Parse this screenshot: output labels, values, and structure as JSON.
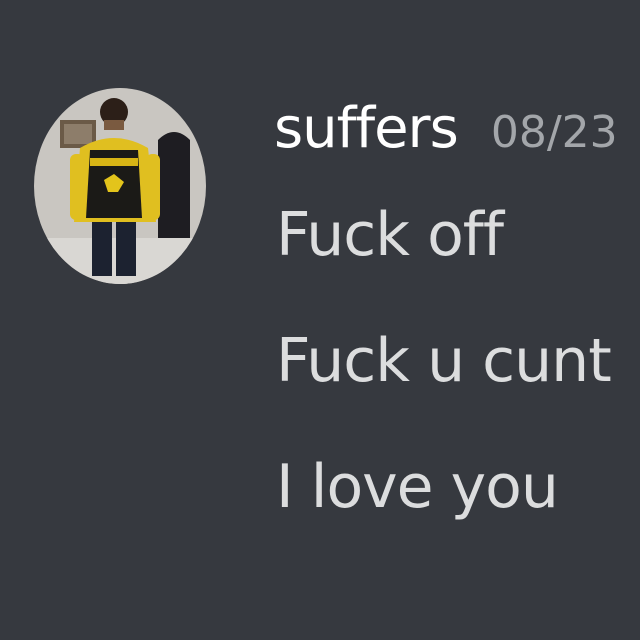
{
  "message": {
    "username": "suffers",
    "timestamp": "08/23",
    "avatar": "avatar-photo",
    "lines": [
      "Fuck off",
      "Fuck u cunt",
      "I love you"
    ]
  },
  "colors": {
    "background": "#36393f",
    "username": "#ffffff",
    "timestamp": "#a3a6aa",
    "message_text": "#dcddde"
  }
}
